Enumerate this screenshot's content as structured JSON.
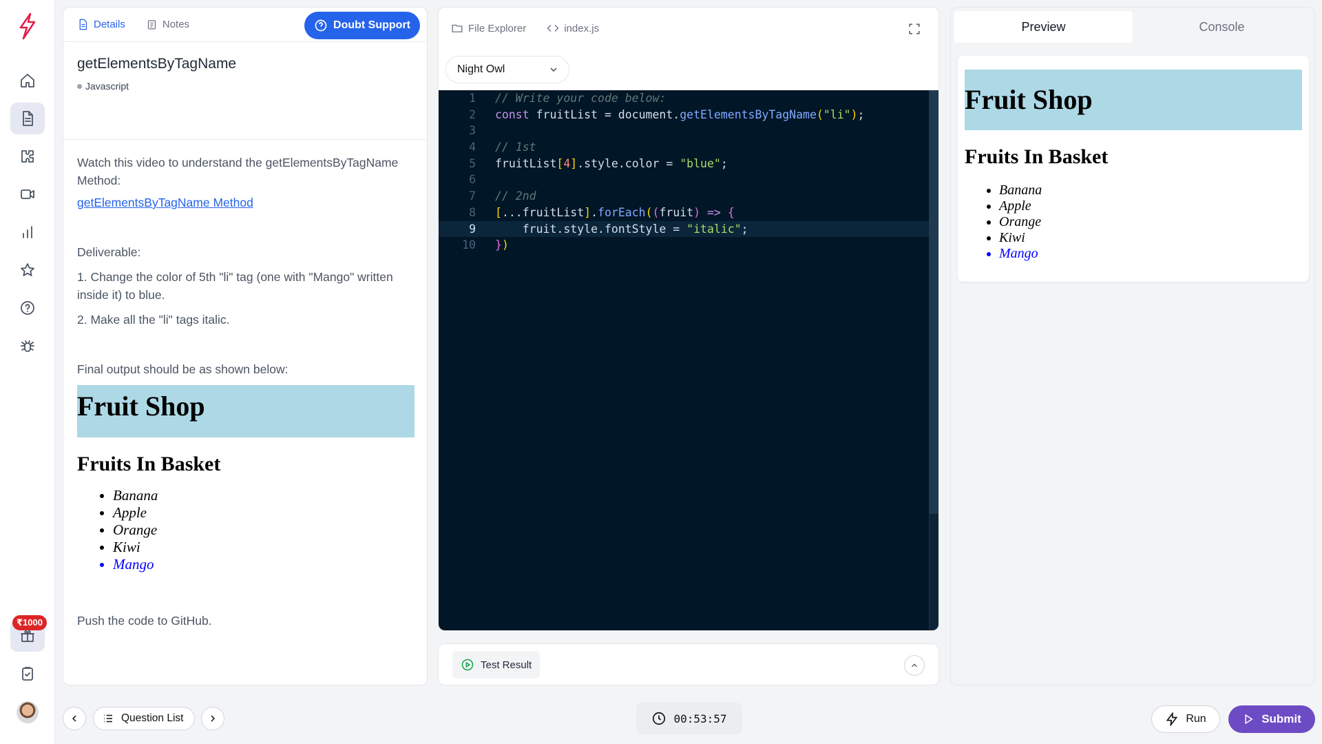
{
  "sidebar": {
    "reward_badge": "₹1000",
    "items": [
      {
        "icon": "home-icon"
      },
      {
        "icon": "document-icon",
        "active": true
      },
      {
        "icon": "puzzle-icon"
      },
      {
        "icon": "video-icon"
      },
      {
        "icon": "bar-chart-icon"
      },
      {
        "icon": "star-icon"
      },
      {
        "icon": "help-icon"
      },
      {
        "icon": "bug-icon"
      },
      {
        "icon": "gift-icon"
      },
      {
        "icon": "clipboard-check-icon"
      }
    ]
  },
  "left_panel": {
    "tabs": {
      "details": "Details",
      "notes": "Notes"
    },
    "doubt_button": "Doubt Support",
    "question_title": "getElementsByTagName",
    "language_tag": "Javascript",
    "intro": "Watch this video to understand the getElementsByTagName Method:",
    "link": "getElementsByTagName Method",
    "deliverable_heading": "Deliverable:",
    "step1": "1. Change the color of 5th \"li\" tag (one with \"Mango\" written inside it) to blue.",
    "step2": "2. Make all the \"li\" tags italic.",
    "final_output_text": "Final output should be as shown below:",
    "demo": {
      "heading": "Fruit Shop",
      "subheading": "Fruits In Basket",
      "fruits": [
        "Banana",
        "Apple",
        "Orange",
        "Kiwi",
        "Mango"
      ]
    },
    "push_text": "Push the code to GitHub."
  },
  "editor": {
    "tabs": {
      "file_explorer": "File Explorer",
      "file": "index.js"
    },
    "theme": "Night Owl",
    "line_numbers": [
      "1",
      "2",
      "3",
      "4",
      "5",
      "6",
      "7",
      "8",
      "9",
      "10"
    ],
    "current_line": 9
  },
  "test_result": {
    "label": "Test Result"
  },
  "preview": {
    "tabs": {
      "preview": "Preview",
      "console": "Console"
    },
    "heading": "Fruit Shop",
    "subheading": "Fruits In Basket",
    "fruits": [
      "Banana",
      "Apple",
      "Orange",
      "Kiwi",
      "Mango"
    ]
  },
  "bottom_bar": {
    "question_list": "Question List",
    "timer": "00:53:57",
    "run": "Run",
    "submit": "Submit"
  },
  "colors": {
    "accent": "#2563eb",
    "submit": "#6d4bc4",
    "editor_bg": "#011627",
    "banner": "#add8e6",
    "badge": "#dc2626"
  }
}
